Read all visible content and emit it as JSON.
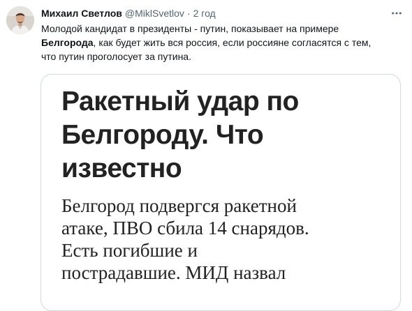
{
  "author": {
    "name": "Михаил Светлов",
    "handle": "@MiklSvetlov",
    "separator": "·",
    "time": "2 год"
  },
  "tweet": {
    "line1": "Молодой кандидат в президенты - путин, показывает на примере",
    "bold_word": "Белгорода",
    "line2_rest": ", как будет жить вся россия, если россияне согласятся с тем,",
    "line3": "что путин проголосует за путина."
  },
  "card": {
    "headline_lines": [
      "Ракетный удар по",
      "Белгороду. Что",
      "известно"
    ],
    "lead_lines": [
      "Белгород подвергся ракетной",
      "атаке, ПВО сбила 14 снарядов.",
      "Есть погибшие и",
      "пострадавшие. МИД назвал"
    ]
  },
  "icons": {
    "avatar": "avatar-photo",
    "more": "more-horizontal-icon"
  },
  "colors": {
    "text": "#0f1419",
    "secondary": "#536471",
    "border": "#cfd9de",
    "headline": "#222222"
  }
}
